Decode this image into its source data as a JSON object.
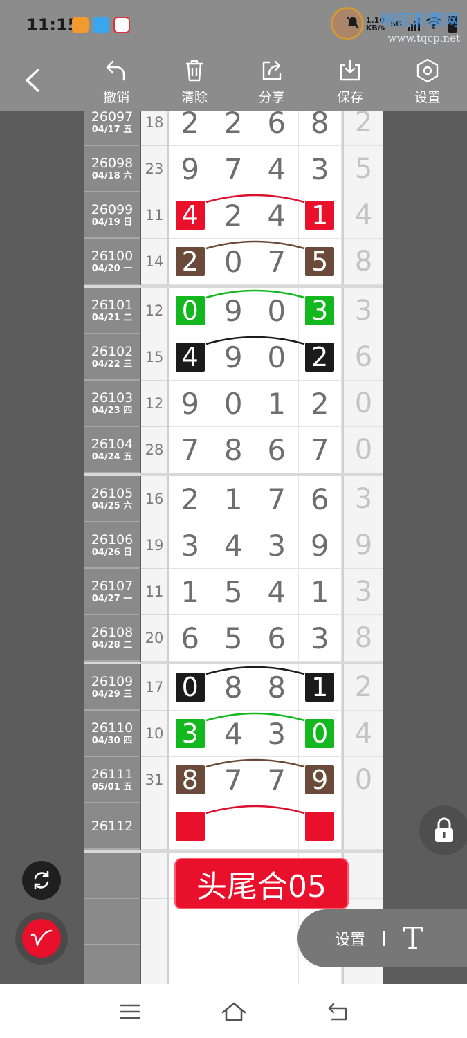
{
  "status_bar": {
    "time": "11:15",
    "net_speed": "1.10\nKB/s",
    "net_speed_top": "1.10",
    "net_speed_bottom": "KB/s",
    "network": "5G",
    "watermark_title": "特区彩票网",
    "watermark_url": "www.tqcp.net"
  },
  "toolbar": {
    "undo_label": "撤销",
    "clear_label": "清除",
    "share_label": "分享",
    "save_label": "保存",
    "settings_label": "设置"
  },
  "colors": {
    "red": "#e8102b",
    "brown": "#6b4a3a",
    "green": "#12b81e",
    "black": "#1b1b1b",
    "arc_red": "#d8112e",
    "arc_brown": "#6b4a3a",
    "arc_green": "#12b81e",
    "arc_black": "#1b1b1b"
  },
  "rows": [
    {
      "issue": "26097",
      "date": "04/17 五",
      "sum": "18",
      "digits": [
        "2",
        "2",
        "6",
        "8"
      ],
      "tail": "2",
      "mark": ""
    },
    {
      "issue": "26098",
      "date": "04/18 六",
      "sum": "23",
      "digits": [
        "9",
        "7",
        "4",
        "3"
      ],
      "tail": "5",
      "mark": ""
    },
    {
      "issue": "26099",
      "date": "04/19 日",
      "sum": "11",
      "digits": [
        "4",
        "2",
        "4",
        "1"
      ],
      "tail": "4",
      "mark": "red"
    },
    {
      "issue": "26100",
      "date": "04/20 一",
      "sum": "14",
      "digits": [
        "2",
        "0",
        "7",
        "5"
      ],
      "tail": "8",
      "mark": "brown"
    },
    {
      "issue": "26101",
      "date": "04/21 二",
      "sum": "12",
      "digits": [
        "0",
        "9",
        "0",
        "3"
      ],
      "tail": "3",
      "mark": "green"
    },
    {
      "issue": "26102",
      "date": "04/22 三",
      "sum": "15",
      "digits": [
        "4",
        "9",
        "0",
        "2"
      ],
      "tail": "6",
      "mark": "black"
    },
    {
      "issue": "26103",
      "date": "04/23 四",
      "sum": "12",
      "digits": [
        "9",
        "0",
        "1",
        "2"
      ],
      "tail": "0",
      "mark": ""
    },
    {
      "issue": "26104",
      "date": "04/24 五",
      "sum": "28",
      "digits": [
        "7",
        "8",
        "6",
        "7"
      ],
      "tail": "0",
      "mark": ""
    },
    {
      "issue": "26105",
      "date": "04/25 六",
      "sum": "16",
      "digits": [
        "2",
        "1",
        "7",
        "6"
      ],
      "tail": "3",
      "mark": ""
    },
    {
      "issue": "26106",
      "date": "04/26 日",
      "sum": "19",
      "digits": [
        "3",
        "4",
        "3",
        "9"
      ],
      "tail": "9",
      "mark": ""
    },
    {
      "issue": "26107",
      "date": "04/27 一",
      "sum": "11",
      "digits": [
        "1",
        "5",
        "4",
        "1"
      ],
      "tail": "3",
      "mark": ""
    },
    {
      "issue": "26108",
      "date": "04/28 二",
      "sum": "20",
      "digits": [
        "6",
        "5",
        "6",
        "3"
      ],
      "tail": "8",
      "mark": ""
    },
    {
      "issue": "26109",
      "date": "04/29 三",
      "sum": "17",
      "digits": [
        "0",
        "8",
        "8",
        "1"
      ],
      "tail": "2",
      "mark": "black"
    },
    {
      "issue": "26110",
      "date": "04/30 四",
      "sum": "10",
      "digits": [
        "3",
        "4",
        "3",
        "0"
      ],
      "tail": "4",
      "mark": "green"
    },
    {
      "issue": "26111",
      "date": "05/01 五",
      "sum": "31",
      "digits": [
        "8",
        "7",
        "7",
        "9"
      ],
      "tail": "0",
      "mark": "brown"
    },
    {
      "issue": "26112",
      "date": "",
      "sum": "",
      "digits": [
        "",
        "",
        "",
        ""
      ],
      "tail": "",
      "mark": "red"
    }
  ],
  "result_badge": "头尾合05",
  "floating": {
    "settings_label": "设置"
  }
}
